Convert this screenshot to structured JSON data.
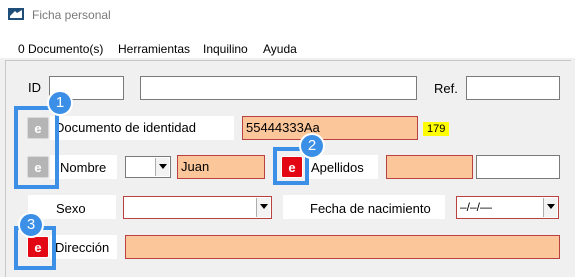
{
  "window": {
    "title": "Ficha personal"
  },
  "menu": {
    "items": [
      "0 Documento(s)",
      "Herramientas",
      "Inquilino",
      "Ayuda"
    ]
  },
  "form": {
    "id_label": "ID",
    "id_value": "",
    "id_name_value": "",
    "ref_label": "Ref.",
    "ref_value": "",
    "doc_label": "Documento de identidad",
    "doc_value": "55444333Aa",
    "doc_length": "179",
    "nombre_label": "Nombre",
    "treatment_value": "",
    "nombre_value": "Juan",
    "apellidos_label": "Apellidos",
    "apellido1_value": "",
    "apellido2_value": "",
    "sexo_label": "Sexo",
    "sexo_value": "",
    "fecha_label": "Fecha de nacimiento",
    "fecha_value": "–/–/—",
    "direccion_label": "Dirección",
    "direccion_value": "",
    "edit_button_label": "e"
  },
  "annotations": {
    "badges": [
      "1",
      "2",
      "3"
    ],
    "color": "#3b8fe6"
  },
  "colors": {
    "required_field": "#fbc69a",
    "error_button": "#e30613",
    "disabled_button": "#b5b5b5"
  }
}
